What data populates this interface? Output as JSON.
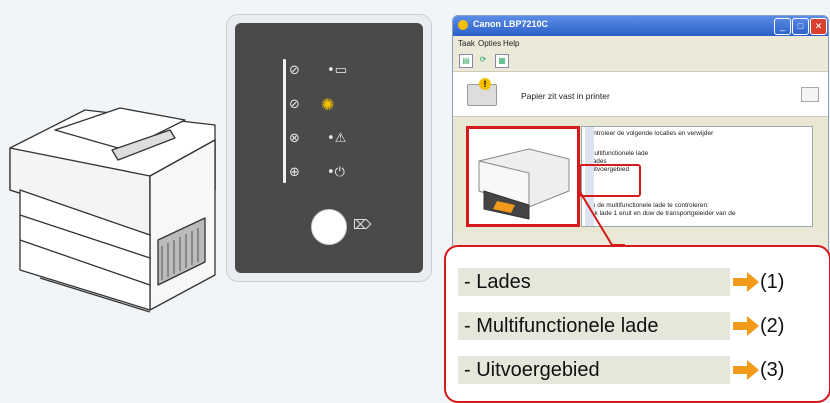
{
  "dialog": {
    "title": "Canon LBP7210C",
    "menu": [
      "Taak",
      "Opties",
      "Help"
    ],
    "status_message": "Papier zit vast in printer",
    "detail_lines": [
      "Controleer de volgende locaties en verwijder",
      "- Multifunctionele lade",
      "- Lades",
      "- Uitvoergebied",
      "Om de multifunctionele lade te controleren:",
      "Trek lade 1 eruit en duw de transportgeleider van de"
    ]
  },
  "callout": {
    "items": [
      {
        "label": "- Lades",
        "number": "(1)"
      },
      {
        "label": "- Multifunctionele lade",
        "number": "(2)"
      },
      {
        "label": "- Uitvoergebied",
        "number": "(3)"
      }
    ]
  },
  "colors": {
    "highlight": "#d41a1a",
    "arrow": "#f39a1b",
    "led_blink": "#f5c000"
  }
}
